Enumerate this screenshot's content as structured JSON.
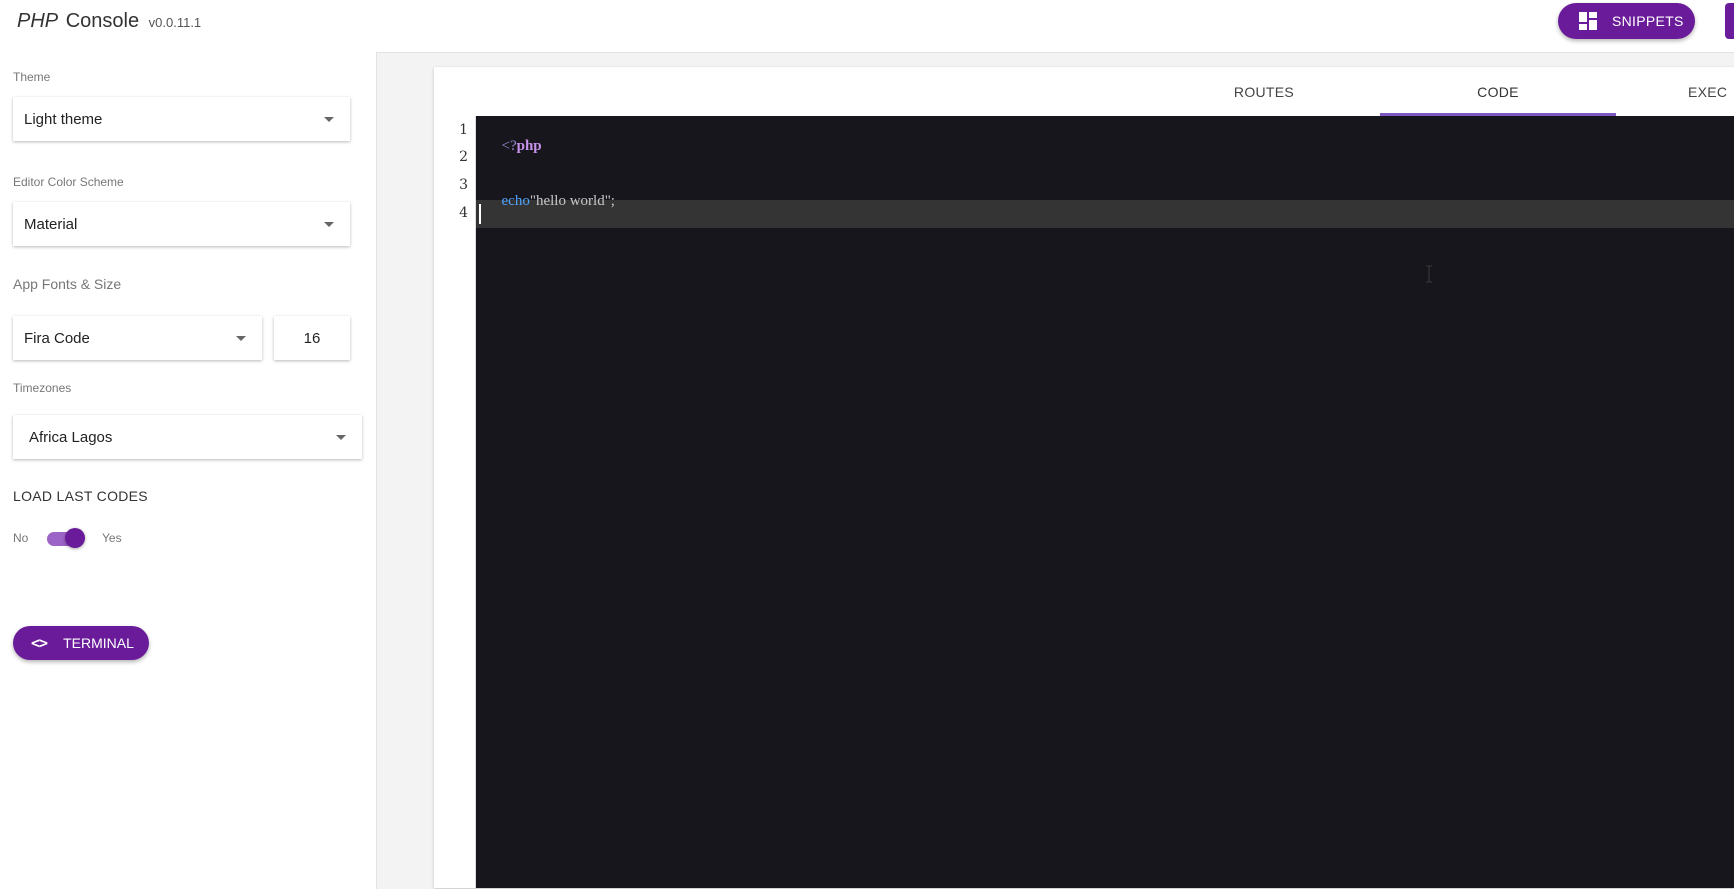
{
  "header": {
    "brand_php": "PHP",
    "brand_console": "Console",
    "version": "v0.0.11.1",
    "snippets_label": "SNIPPETS"
  },
  "sidebar": {
    "theme_label": "Theme",
    "theme_value": "Light theme",
    "color_scheme_label": "Editor Color Scheme",
    "color_scheme_value": "Material",
    "fonts_label": "App Fonts & Size",
    "font_value": "Fira Code",
    "font_size_value": "16",
    "timezones_label": "Timezones",
    "timezone_value": "Africa Lagos",
    "load_last_codes_label": "LOAD LAST CODES",
    "toggle_no": "No",
    "toggle_yes": "Yes",
    "toggle_on": true,
    "terminal_label": "TERMINAL",
    "terminal_icon": "<>"
  },
  "tabs": [
    {
      "label": "ROUTES",
      "active": false
    },
    {
      "label": "CODE",
      "active": true
    },
    {
      "label": "EXEC",
      "active": false
    }
  ],
  "editor": {
    "line_numbers": [
      "1",
      "2",
      "3",
      "4"
    ],
    "lines": {
      "l1_open": "<?",
      "l1_php": "php",
      "l3_echo": "echo",
      "l3_string": "\"hello world\";"
    },
    "active_line": 4
  },
  "colors": {
    "accent": "#6a1b9a",
    "tab_indicator": "#7e57c2",
    "editor_bg": "#17161d",
    "active_line_bg": "#343434",
    "keyword": "#c792ea",
    "function": "#4fa3ff"
  },
  "icons": {
    "snippets": "dashboard-icon",
    "terminal": "code-brackets-icon",
    "caret": "chevron-down-icon",
    "mouse": "text-cursor-icon"
  }
}
